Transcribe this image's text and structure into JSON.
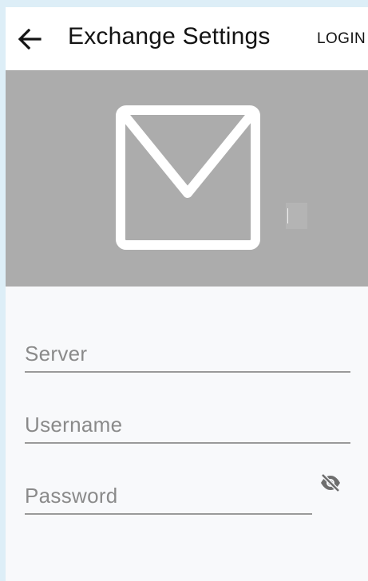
{
  "header": {
    "title": "Exchange Settings",
    "login_label": "LOGIN",
    "back_icon": "arrow-back-icon"
  },
  "hero": {
    "icon": "mail-icon",
    "background": "#acacac"
  },
  "form": {
    "server": {
      "placeholder": "Server",
      "value": ""
    },
    "username": {
      "placeholder": "Username",
      "value": ""
    },
    "password": {
      "placeholder": "Password",
      "value": "",
      "visibility_icon": "eye-off-icon"
    }
  },
  "colors": {
    "page_border": "#ddeef7",
    "appbar": "#ffffff",
    "content_bg": "#f8f9fb",
    "text_primary": "#141414",
    "hint_text": "#8a8a8a"
  }
}
